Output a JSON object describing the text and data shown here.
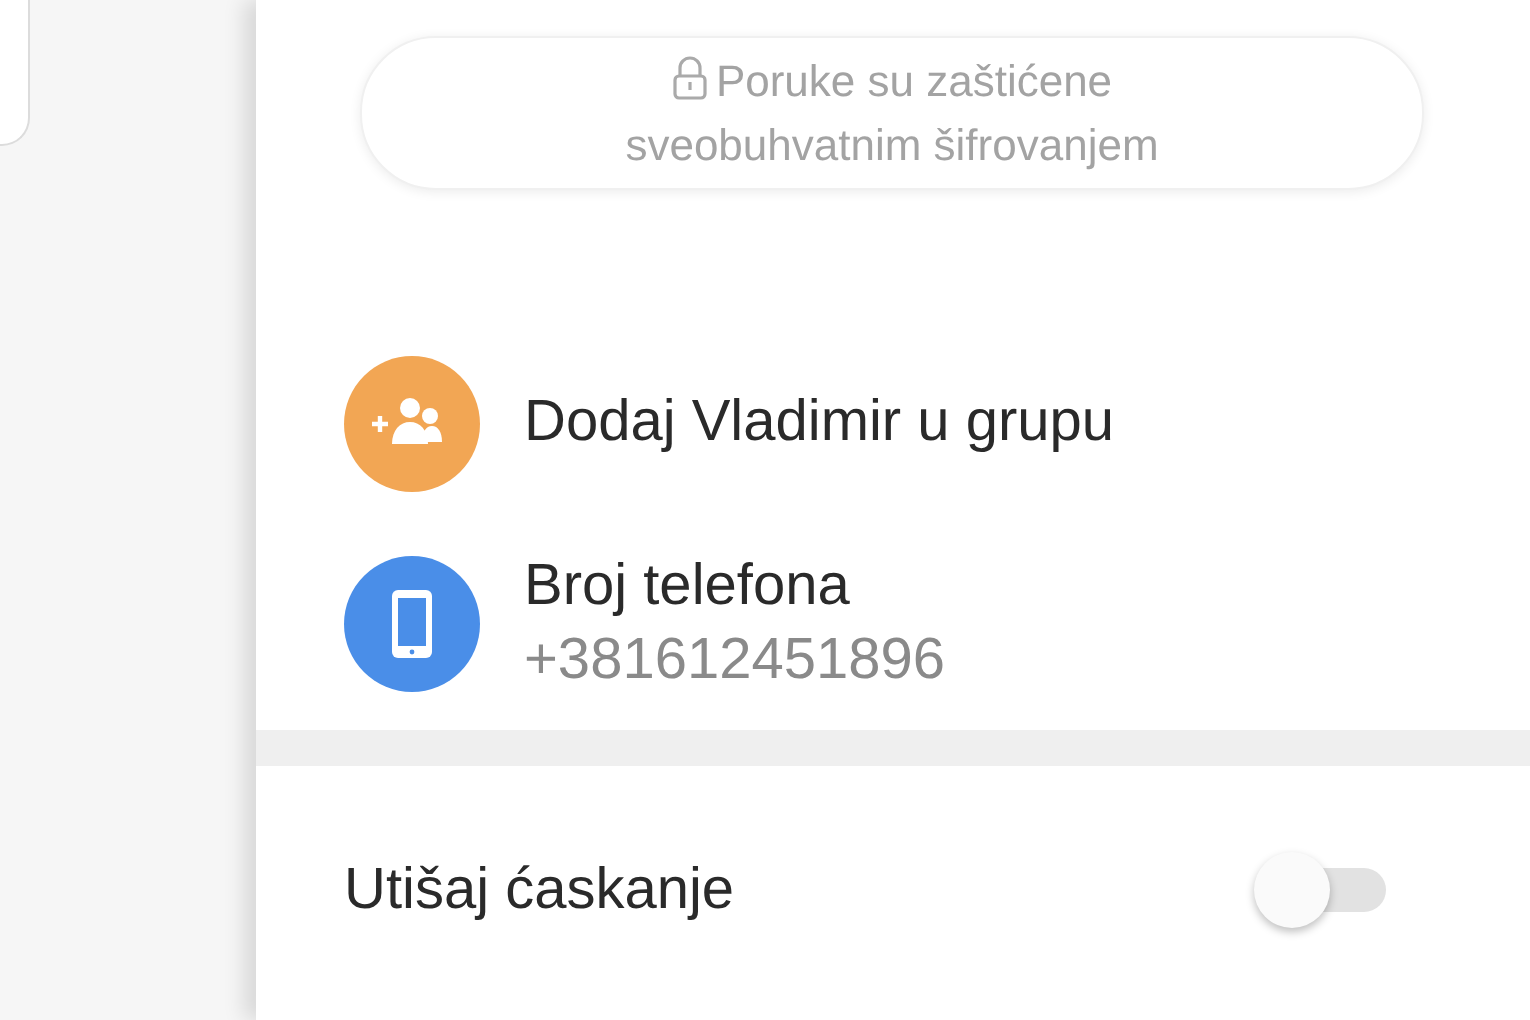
{
  "encryption_notice": {
    "text": "Poruke su zaštićene sveobuhvatnim šifrovanjem"
  },
  "contact_rows": [
    {
      "kind": "add",
      "color": "#f2a654",
      "label": "Dodaj Vladimir u grupu"
    },
    {
      "kind": "phone",
      "color": "#4a8ee8",
      "label": "Broj telefona",
      "value": "+381612451896"
    }
  ],
  "settings": [
    {
      "label": "Utišaj ćaskanje",
      "on": false
    }
  ]
}
